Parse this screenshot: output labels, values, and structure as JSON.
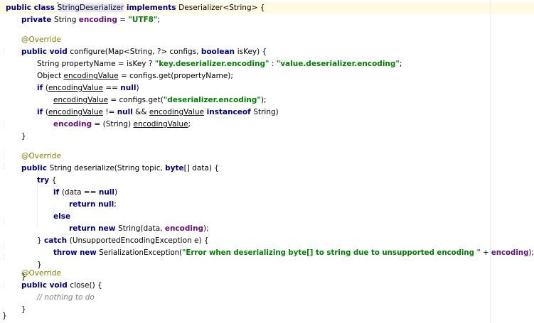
{
  "colors": {
    "keyword": "#000080",
    "string": "#008000",
    "field": "#660e7a",
    "annotation": "#808000",
    "comment": "#808080",
    "current_line": "#fffae3",
    "selection": "#e4e4ff"
  },
  "code": {
    "l1": {
      "kw": "public class ",
      "cls": "StringDeserializer",
      "kw2": " implements ",
      "rest": "Deserializer<String> {"
    },
    "l2": {
      "kw": "private ",
      "a": "String ",
      "fld": "encoding",
      "b": " = ",
      "str": "\"UTF8\"",
      "c": ";"
    },
    "l4": {
      "ann": "@Override"
    },
    "l5": {
      "kw": "public void ",
      "a": "configure(Map<String, ?> configs, ",
      "kw2": "boolean ",
      "b": "isKey) {"
    },
    "l6": {
      "a": "String propertyName = isKey ? ",
      "s1": "\"key.deserializer.encoding\"",
      "b": " : ",
      "s2": "\"value.deserializer.encoding\"",
      "c": ";"
    },
    "l7": {
      "a": "Object ",
      "u": "encodingValue",
      "b": " = configs.get(propertyName);"
    },
    "l8": {
      "kw": "if ",
      "a": "(",
      "u": "encodingValue",
      "b": " == ",
      "kw2": "null",
      "c": ")"
    },
    "l9": {
      "u": "encodingValue",
      "a": " = configs.get(",
      "str": "\"deserializer.encoding\"",
      "b": ");"
    },
    "l10": {
      "kw": "if ",
      "a": "(",
      "u1": "encodingValue",
      "b": " != ",
      "kw2": "null",
      "c": " && ",
      "u2": "encodingValue",
      "kw3": " instanceof ",
      "d": "String)"
    },
    "l11": {
      "fld": "encoding",
      "a": " = (String) ",
      "u": "encodingValue",
      "b": ";"
    },
    "l12": {
      "a": "}"
    },
    "l14": {
      "ann": "@Override"
    },
    "l15": {
      "kw": "public ",
      "a": "String deserialize(String topic, ",
      "kw2": "byte",
      "b": "[] data) {"
    },
    "l16": {
      "kw": "try ",
      "a": "{"
    },
    "l17": {
      "kw": "if ",
      "a": "(data == ",
      "kw2": "null",
      "b": ")"
    },
    "l18": {
      "kw": "return null",
      "a": ";"
    },
    "l19": {
      "kw": "else"
    },
    "l20": {
      "kw": "return new ",
      "a": "String(data, ",
      "fld": "encoding",
      "b": ");"
    },
    "l21": {
      "a": "} ",
      "kw": "catch ",
      "b": "(UnsupportedEncodingException e) {"
    },
    "l22": {
      "kw": "throw new ",
      "a": "SerializationException(",
      "str": "\"Error when deserializing byte[] to string due to unsupported encoding \"",
      "b": " + ",
      "fld": "encoding",
      "c": ");"
    },
    "l23": {
      "a": "}"
    },
    "l24": {
      "a": "}"
    },
    "l26": {
      "ann": "@Override"
    },
    "l27": {
      "kw": "public void ",
      "a": "close() {"
    },
    "l28": {
      "cmt": "// nothing to do"
    },
    "l29": {
      "a": "}"
    },
    "l30": {
      "a": "}"
    }
  }
}
